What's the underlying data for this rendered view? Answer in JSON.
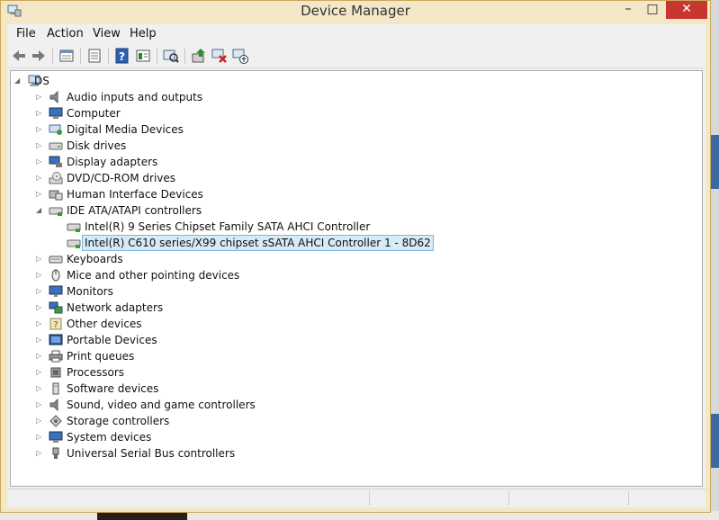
{
  "window": {
    "title": "Device Manager",
    "controls": {
      "minimize": "–",
      "maximize": "□",
      "close": "✕"
    }
  },
  "menu": [
    "File",
    "Action",
    "View",
    "Help"
  ],
  "toolbar": [
    "back-icon",
    "forward-icon",
    "properties-icon",
    "list-icon",
    "help-icon",
    "show-hidden-icon",
    "scan-hardware-icon",
    "update-driver-icon",
    "uninstall-icon",
    "enable-device-icon"
  ],
  "tree": {
    "root": "DS",
    "categories": [
      {
        "label": "Audio inputs and outputs",
        "icon": "speaker-icon"
      },
      {
        "label": "Computer",
        "icon": "computer-icon"
      },
      {
        "label": "Digital Media Devices",
        "icon": "media-device-icon"
      },
      {
        "label": "Disk drives",
        "icon": "disk-drive-icon"
      },
      {
        "label": "Display adapters",
        "icon": "display-adapter-icon"
      },
      {
        "label": "DVD/CD-ROM drives",
        "icon": "dvd-drive-icon"
      },
      {
        "label": "Human Interface Devices",
        "icon": "hid-icon"
      },
      {
        "label": "IDE ATA/ATAPI controllers",
        "icon": "ide-controller-icon",
        "expanded": true,
        "children": [
          {
            "label": "Intel(R) 9 Series Chipset Family SATA AHCI Controller",
            "icon": "controller-icon"
          },
          {
            "label": "Intel(R) C610 series/X99 chipset sSATA AHCI Controller 1 - 8D62",
            "icon": "controller-icon",
            "selected": true
          }
        ]
      },
      {
        "label": "Keyboards",
        "icon": "keyboard-icon"
      },
      {
        "label": "Mice and other pointing devices",
        "icon": "mouse-icon"
      },
      {
        "label": "Monitors",
        "icon": "monitor-icon"
      },
      {
        "label": "Network adapters",
        "icon": "network-icon"
      },
      {
        "label": "Other devices",
        "icon": "other-device-icon"
      },
      {
        "label": "Portable Devices",
        "icon": "portable-device-icon"
      },
      {
        "label": "Print queues",
        "icon": "printer-icon"
      },
      {
        "label": "Processors",
        "icon": "processor-icon"
      },
      {
        "label": "Software devices",
        "icon": "software-device-icon"
      },
      {
        "label": "Sound, video and game controllers",
        "icon": "sound-icon"
      },
      {
        "label": "Storage controllers",
        "icon": "storage-controller-icon"
      },
      {
        "label": "System devices",
        "icon": "system-device-icon"
      },
      {
        "label": "Universal Serial Bus controllers",
        "icon": "usb-icon"
      }
    ]
  },
  "colors": {
    "titlebar": "#f4e7c8",
    "close_button": "#c7372f",
    "selection_fill": "#d6eaf8",
    "selection_border": "#7fb6df"
  }
}
